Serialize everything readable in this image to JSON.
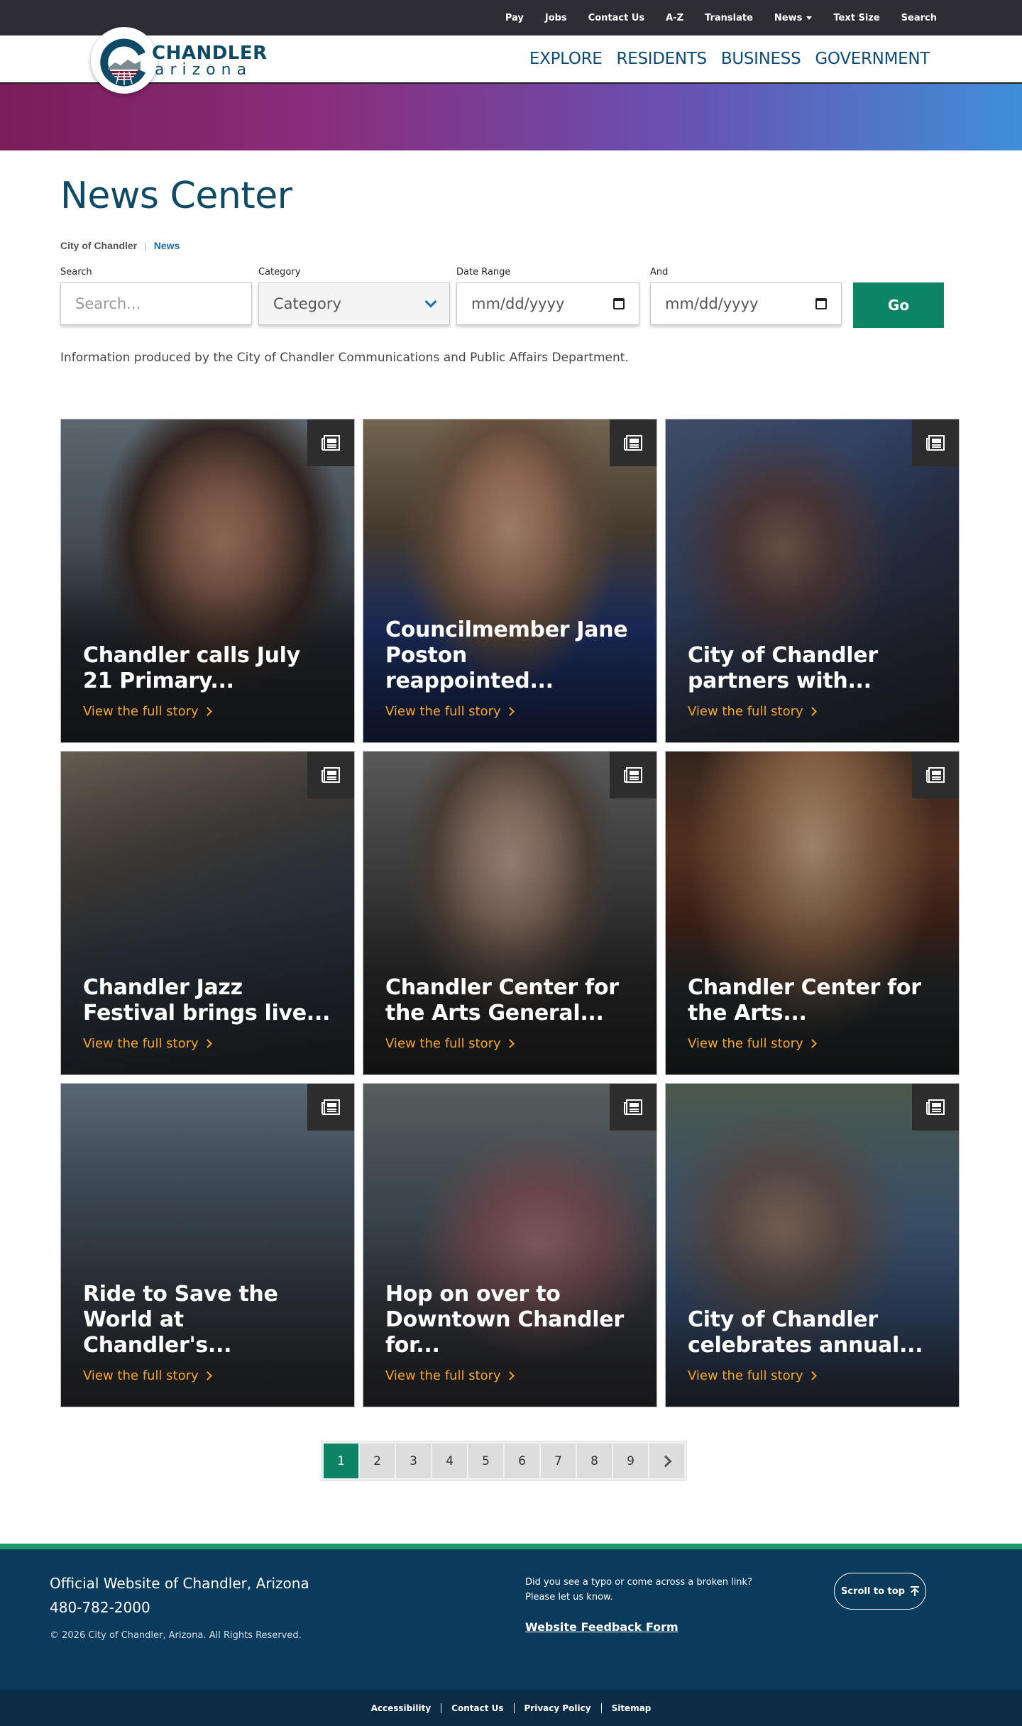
{
  "utility_nav": {
    "items": [
      "Pay",
      "Jobs",
      "Contact Us",
      "A-Z",
      "Translate",
      "News",
      "Text Size",
      "Search"
    ]
  },
  "logo": {
    "name": "CHANDLER",
    "sub": "arizona"
  },
  "main_nav": {
    "items": [
      "EXPLORE",
      "RESIDENTS",
      "BUSINESS",
      "GOVERNMENT"
    ]
  },
  "page": {
    "title": "News Center",
    "breadcrumb": {
      "home": "City of Chandler",
      "current": "News"
    },
    "info": "Information produced by the City of Chandler Communications and Public Affairs Department."
  },
  "filters": {
    "search_label": "Search",
    "search_placeholder": "Search...",
    "category_label": "Category",
    "category_value": "Category",
    "date_range_label": "Date Range",
    "date_from_value": "mm/dd/yyyy",
    "and_label": "And",
    "date_to_value": "mm/dd/yyyy",
    "go_label": "Go"
  },
  "news": {
    "more_label": "View the full story",
    "cards": [
      {
        "title": "Chandler calls July 21 Primary..."
      },
      {
        "title": "Councilmember Jane Poston reappointed..."
      },
      {
        "title": "City of Chandler partners with..."
      },
      {
        "title": "Chandler Jazz Festival brings live..."
      },
      {
        "title": "Chandler Center for the Arts General..."
      },
      {
        "title": "Chandler Center for the Arts..."
      },
      {
        "title": "Ride to Save the World at Chandler's..."
      },
      {
        "title": "Hop on over to Downtown Chandler for..."
      },
      {
        "title": "City of Chandler celebrates annual..."
      }
    ]
  },
  "pagination": {
    "pages": [
      "1",
      "2",
      "3",
      "4",
      "5",
      "6",
      "7",
      "8",
      "9"
    ],
    "current": "1"
  },
  "footer": {
    "site": "Official Website of Chandler, Arizona",
    "phone": "480-782-2000",
    "copyright": "© 2026 City of Chandler, Arizona. All Rights Reserved.",
    "typo": "Did you see a typo or come across a broken link? Please let us know.",
    "feedback_link": "Website Feedback Form",
    "scroll_top": "Scroll to top",
    "bottom_links": [
      "Accessibility",
      "Contact Us",
      "Privacy Policy",
      "Sitemap"
    ]
  },
  "colors": {
    "brand_blue": "#0e4a66",
    "accent_green": "#0d8464",
    "link_orange": "#f5a623",
    "footer_navy": "#0a3a5c"
  }
}
